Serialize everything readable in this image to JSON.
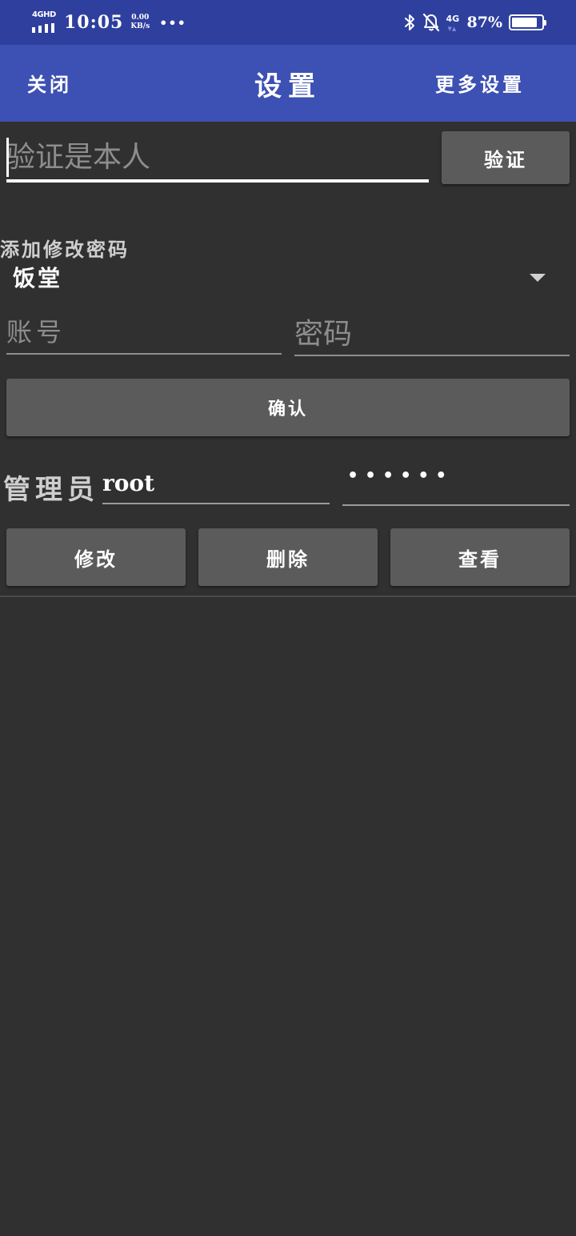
{
  "status_bar": {
    "network_label": "4GHD",
    "time": "10:05",
    "speed_value": "0.00",
    "speed_unit": "KB/s",
    "more_dots": "•••",
    "cell_label": "4G",
    "battery_percent": "87%",
    "battery_level": 0.87
  },
  "app_bar": {
    "close_label": "关闭",
    "title": "设置",
    "more_label": "更多设置",
    "color": "#3d50b3"
  },
  "verify": {
    "placeholder": "验证是本人",
    "button_label": "验证"
  },
  "add_password": {
    "section_label": "添加修改密码",
    "selected_option": "饭堂",
    "account_placeholder": "账号",
    "password_placeholder": "密码",
    "confirm_label": "确认"
  },
  "admin": {
    "label": "管理员",
    "username": "root",
    "password_mask": "••••••",
    "modify_label": "修改",
    "delete_label": "删除",
    "view_label": "查看"
  }
}
